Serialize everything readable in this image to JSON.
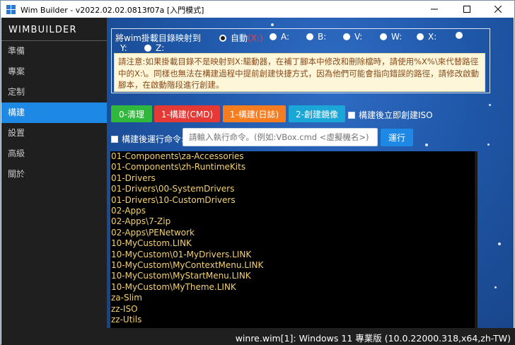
{
  "window": {
    "title": "Wim Builder - v2022.02.02.0813f07a [入門模式]",
    "minimize_icon": "minimize-icon",
    "maximize_icon": "maximize-icon",
    "close_icon": "close-icon"
  },
  "sidebar": {
    "brand": "WIMBUILDER",
    "items": [
      {
        "label": "準備"
      },
      {
        "label": "專案"
      },
      {
        "label": "定制"
      },
      {
        "label": "構建",
        "active": true
      },
      {
        "label": "設置"
      },
      {
        "label": "高級"
      },
      {
        "label": "關於"
      }
    ]
  },
  "mapping": {
    "label": "將wim掛載目錄映射到",
    "options": [
      {
        "label": "自動",
        "suffix": "(X:)",
        "checked": true
      },
      {
        "label": "A:"
      },
      {
        "label": "B:"
      },
      {
        "label": "V:"
      },
      {
        "label": "W:"
      },
      {
        "label": "X:"
      },
      {
        "label": "Y:"
      },
      {
        "label": "Z:"
      }
    ]
  },
  "note": {
    "text": "請注意:如果掛載目錄不是映射到X:驅動器，在補丁腳本中修改和刪除檔時，請使用%X%\\來代替路徑中的X:\\。同樣也無法在構建過程中提前創建快捷方式，因為他們可能會指向錯誤的路徑，請修改啟動腳本，在啟動階段進行創建。"
  },
  "actions": {
    "clean": "0-清理",
    "build_cmd": "1-構建(CMD)",
    "build_log": "1-構建(日誌)",
    "create_image": "2-創建鏡像",
    "create_iso_after": "構建後立即創建ISO",
    "run_after_label": "構建後運行命令:",
    "cmd_placeholder": "請輸入執行命令。(例如:VBox.cmd <虛擬機名>)",
    "run": "運行"
  },
  "colors": {
    "clean": "#2fb83c",
    "build_cmd": "#e53935",
    "build_log": "#f57c1f",
    "create_image": "#1aa7d8",
    "run": "#1e88e5",
    "active_nav": "#1e88e5",
    "list_text": "#f4d070"
  },
  "list": [
    "01-Components\\za-Accessories",
    "01-Components\\zh-RuntimeKits",
    "01-Drivers",
    "01-Drivers\\00-SystemDrivers",
    "01-Drivers\\10-CustomDrivers",
    "02-Apps",
    "02-Apps\\7-Zip",
    "02-Apps\\PENetwork",
    "10-MyCustom.LINK",
    "10-MyCustom\\01-MyDrivers.LINK",
    "10-MyCustom\\MyContextMenu.LINK",
    "10-MyCustom\\MyStartMenu.LINK",
    "10-MyCustom\\MyTheme.LINK",
    "za-Slim",
    "zz-ISO",
    "zz-Utils"
  ],
  "status": {
    "text": "winre.wim[1]: Windows 11 專業版 (10.0.22000.318,x64,zh-TW)"
  }
}
